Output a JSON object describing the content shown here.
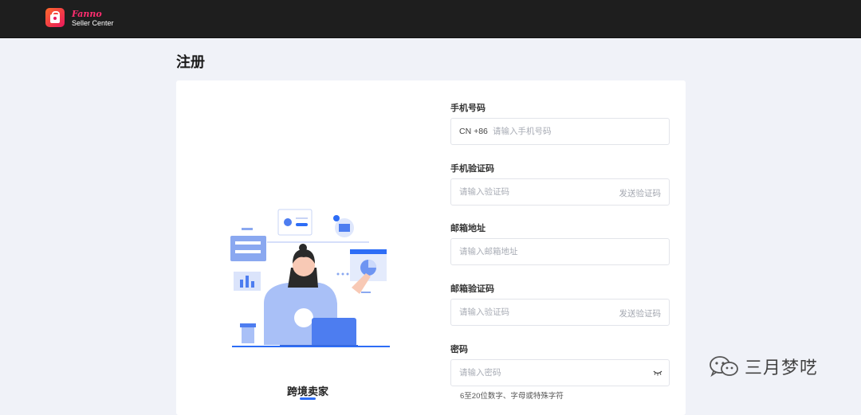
{
  "header": {
    "brand": "Fanno",
    "brand_sub": "Seller Center"
  },
  "page": {
    "title": "注册"
  },
  "illustration": {
    "caption": "跨境卖家"
  },
  "form": {
    "phone": {
      "label": "手机号码",
      "prefix": "CN +86",
      "placeholder": "请输入手机号码"
    },
    "phone_code": {
      "label": "手机验证码",
      "placeholder": "请输入验证码",
      "send_label": "发送验证码"
    },
    "email": {
      "label": "邮箱地址",
      "placeholder": "请输入邮箱地址"
    },
    "email_code": {
      "label": "邮箱验证码",
      "placeholder": "请输入验证码",
      "send_label": "发送验证码"
    },
    "password": {
      "label": "密码",
      "placeholder": "请输入密码",
      "hint": "6至20位数字、字母或特殊字符",
      "toggle_icon": "eye-closed-icon"
    }
  },
  "watermark": {
    "text": "三月梦呓",
    "icon": "wechat-icon"
  },
  "colors": {
    "accent": "#2d6df6",
    "brand": "#ff2d6f",
    "topbar": "#1e1e1e"
  }
}
